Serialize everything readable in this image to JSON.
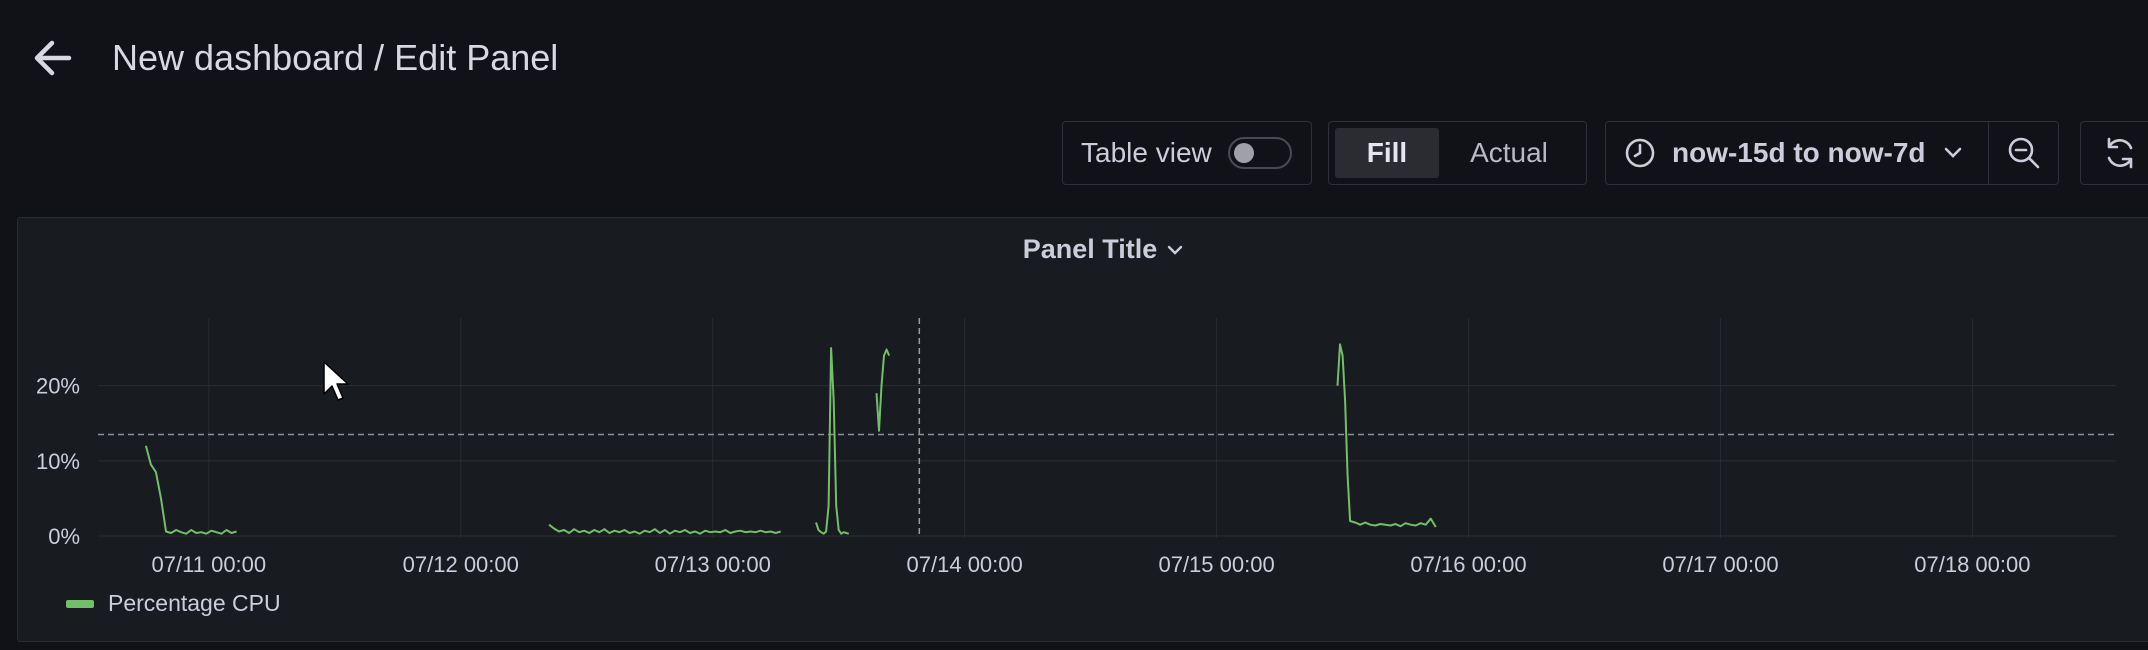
{
  "header": {
    "title": "New dashboard / Edit Panel",
    "back_icon": "arrow-left-icon"
  },
  "toolbar": {
    "table_view_label": "Table view",
    "table_view_on": false,
    "fill_label": "Fill",
    "actual_label": "Actual",
    "selected_mode": "Fill",
    "time_range": "now-15d to now-7d",
    "clock_icon": "clock-icon",
    "zoom_icon": "zoom-out-icon",
    "refresh_icon": "refresh-icon"
  },
  "panel": {
    "title": "Panel Title",
    "legend": {
      "label": "Percentage CPU",
      "color": "#73bf69"
    }
  },
  "colors": {
    "background": "#111217",
    "panel": "#181b1f",
    "series": "#73bf69",
    "grid": "#2a2c32",
    "threshold": "#8e8f96"
  },
  "chart_data": {
    "type": "line",
    "series": [
      {
        "name": "Percentage CPU",
        "color": "#73bf69"
      }
    ],
    "x_ticks": [
      "07/11 00:00",
      "07/12 00:00",
      "07/13 00:00",
      "07/14 00:00",
      "07/15 00:00",
      "07/16 00:00",
      "07/17 00:00",
      "07/18 00:00"
    ],
    "y_ticks": [
      "0%",
      "10%",
      "20%"
    ],
    "xlim_days": [
      -0.44,
      7.57
    ],
    "ylim": [
      0,
      29
    ],
    "threshold_y": 13.5,
    "crosshair_x": 2.82,
    "segments": [
      [
        [
          -0.25,
          12.0
        ],
        [
          -0.23,
          9.5
        ],
        [
          -0.21,
          8.5
        ],
        [
          -0.19,
          5.0
        ],
        [
          -0.17,
          0.6
        ],
        [
          -0.15,
          0.4
        ],
        [
          -0.13,
          0.8
        ],
        [
          -0.11,
          0.5
        ],
        [
          -0.09,
          0.3
        ],
        [
          -0.07,
          0.8
        ],
        [
          -0.05,
          0.4
        ],
        [
          -0.03,
          0.5
        ],
        [
          -0.01,
          0.3
        ],
        [
          0.01,
          0.7
        ],
        [
          0.03,
          0.5
        ],
        [
          0.05,
          0.3
        ],
        [
          0.07,
          0.8
        ],
        [
          0.09,
          0.4
        ],
        [
          0.11,
          0.6
        ]
      ],
      [
        [
          1.35,
          1.5
        ],
        [
          1.37,
          1.0
        ],
        [
          1.39,
          0.6
        ],
        [
          1.41,
          0.8
        ],
        [
          1.43,
          0.4
        ],
        [
          1.45,
          0.9
        ],
        [
          1.47,
          0.5
        ],
        [
          1.49,
          0.7
        ],
        [
          1.51,
          0.4
        ],
        [
          1.53,
          0.8
        ],
        [
          1.55,
          0.5
        ],
        [
          1.57,
          0.9
        ],
        [
          1.59,
          0.4
        ],
        [
          1.61,
          0.7
        ],
        [
          1.63,
          0.5
        ],
        [
          1.65,
          0.8
        ],
        [
          1.67,
          0.4
        ],
        [
          1.69,
          0.6
        ],
        [
          1.71,
          0.3
        ],
        [
          1.73,
          0.7
        ],
        [
          1.75,
          0.5
        ],
        [
          1.77,
          0.9
        ],
        [
          1.79,
          0.4
        ],
        [
          1.81,
          0.8
        ],
        [
          1.83,
          0.3
        ],
        [
          1.85,
          0.7
        ],
        [
          1.87,
          0.5
        ],
        [
          1.89,
          0.8
        ],
        [
          1.91,
          0.4
        ],
        [
          1.93,
          0.6
        ],
        [
          1.95,
          0.3
        ],
        [
          1.97,
          0.7
        ],
        [
          1.99,
          0.5
        ],
        [
          2.01,
          0.6
        ],
        [
          2.03,
          0.5
        ],
        [
          2.05,
          0.8
        ],
        [
          2.07,
          0.4
        ],
        [
          2.09,
          0.6
        ],
        [
          2.11,
          0.7
        ],
        [
          2.13,
          0.5
        ],
        [
          2.15,
          0.6
        ],
        [
          2.17,
          0.5
        ],
        [
          2.19,
          0.7
        ],
        [
          2.21,
          0.5
        ],
        [
          2.23,
          0.6
        ],
        [
          2.25,
          0.4
        ],
        [
          2.27,
          0.6
        ]
      ],
      [
        [
          2.41,
          1.8
        ],
        [
          2.42,
          0.8
        ],
        [
          2.43,
          0.5
        ],
        [
          2.44,
          0.3
        ],
        [
          2.45,
          0.6
        ],
        [
          2.46,
          4.0
        ],
        [
          2.47,
          25.0
        ],
        [
          2.48,
          18.0
        ],
        [
          2.49,
          4.0
        ],
        [
          2.5,
          0.8
        ],
        [
          2.51,
          0.3
        ],
        [
          2.52,
          0.5
        ],
        [
          2.53,
          0.4
        ],
        [
          2.54,
          0.3
        ]
      ],
      [
        [
          2.65,
          19.0
        ],
        [
          2.66,
          14.0
        ],
        [
          2.67,
          20.0
        ],
        [
          2.68,
          24.0
        ],
        [
          2.69,
          24.8
        ],
        [
          2.7,
          24.0
        ]
      ],
      [
        [
          4.48,
          20.0
        ],
        [
          4.49,
          25.5
        ],
        [
          4.5,
          24.0
        ],
        [
          4.51,
          18.0
        ],
        [
          4.52,
          8.0
        ],
        [
          4.53,
          2.0
        ],
        [
          4.55,
          1.8
        ],
        [
          4.57,
          1.5
        ],
        [
          4.59,
          1.8
        ],
        [
          4.61,
          1.5
        ],
        [
          4.63,
          1.4
        ],
        [
          4.65,
          1.6
        ],
        [
          4.67,
          1.5
        ],
        [
          4.69,
          1.4
        ],
        [
          4.71,
          1.6
        ],
        [
          4.73,
          1.3
        ],
        [
          4.75,
          1.7
        ],
        [
          4.77,
          1.5
        ],
        [
          4.79,
          1.4
        ],
        [
          4.81,
          1.7
        ],
        [
          4.83,
          1.5
        ],
        [
          4.85,
          2.3
        ],
        [
          4.87,
          1.2
        ]
      ]
    ]
  }
}
